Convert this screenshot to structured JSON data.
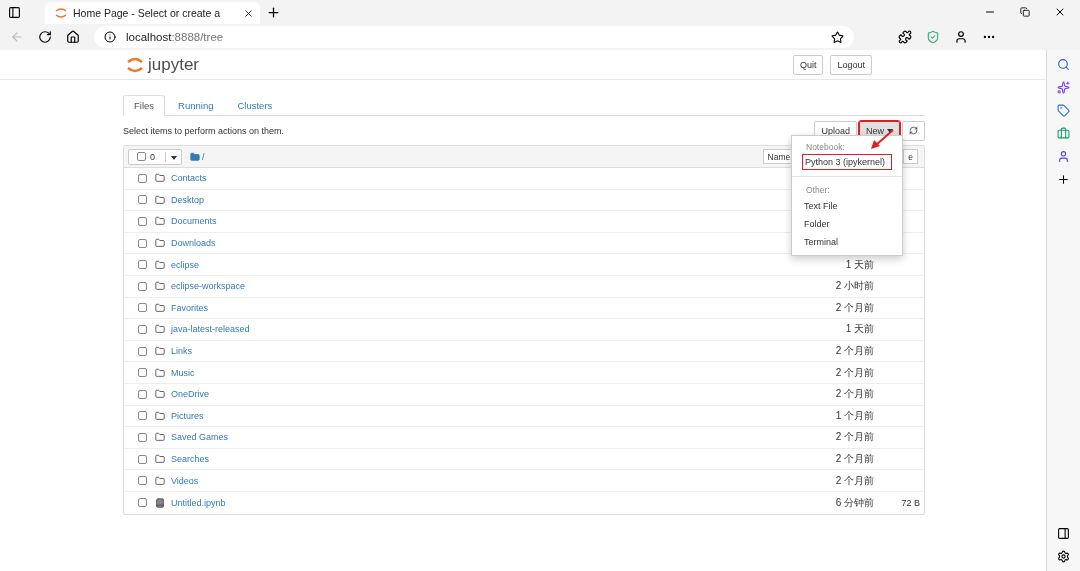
{
  "browser": {
    "tab_title": "Home Page - Select or create a",
    "url_host": "localhost",
    "url_rest": ":8888/tree"
  },
  "header": {
    "logo": "jupyter",
    "buttons": [
      "Quit",
      "Logout"
    ]
  },
  "tabs": [
    {
      "label": "Files",
      "selected": true
    },
    {
      "label": "Running",
      "selected": false
    },
    {
      "label": "Clusters",
      "selected": false
    }
  ],
  "toolbar": {
    "hint": "Select items to perform actions on them.",
    "upload": "Upload",
    "new": {
      "label": "New",
      "outlined": true
    }
  },
  "list_header": {
    "count": "0",
    "path": "/",
    "sort": "Name",
    "column_3": "e"
  },
  "rows": [
    {
      "kind": "folder",
      "name": "Contacts",
      "checked": false
    },
    {
      "kind": "folder",
      "name": "Desktop",
      "checked": false
    },
    {
      "kind": "folder",
      "name": "Documents",
      "checked": false
    },
    {
      "kind": "folder",
      "name": "Downloads",
      "checked": false
    },
    {
      "kind": "folder",
      "name": "eclipse",
      "checked": false,
      "modified": "1 天前"
    },
    {
      "kind": "folder",
      "name": "eclipse-workspace",
      "checked": false,
      "modified": "2 小时前"
    },
    {
      "kind": "folder",
      "name": "Favorites",
      "checked": false,
      "modified": "2 个月前"
    },
    {
      "kind": "folder",
      "name": "java-latest-released",
      "checked": false,
      "modified": "1 天前"
    },
    {
      "kind": "folder",
      "name": "Links",
      "checked": false,
      "modified": "2 个月前"
    },
    {
      "kind": "folder",
      "name": "Music",
      "checked": false,
      "modified": "2 个月前"
    },
    {
      "kind": "folder",
      "name": "OneDrive",
      "checked": false,
      "modified": "2 个月前"
    },
    {
      "kind": "folder",
      "name": "Pictures",
      "checked": false,
      "modified": "1 个月前"
    },
    {
      "kind": "folder",
      "name": "Saved Games",
      "checked": false,
      "modified": "2 个月前"
    },
    {
      "kind": "folder",
      "name": "Searches",
      "checked": false,
      "modified": "2 个月前"
    },
    {
      "kind": "folder",
      "name": "Videos",
      "checked": false,
      "modified": "2 个月前"
    },
    {
      "kind": "notebook",
      "name": "Untitled.ipynb",
      "checked": false,
      "modified": "6 分钟前",
      "size": "72 B"
    }
  ],
  "menu": {
    "sections": [
      {
        "heading": "Notebook:",
        "items": [
          {
            "label": "Python 3 (ipykernel)",
            "outlined": true
          }
        ]
      },
      {
        "heading": "Other:",
        "items": [
          {
            "label": "Text File",
            "outlined": false
          },
          {
            "label": "Folder",
            "outlined": false
          },
          {
            "label": "Terminal",
            "outlined": false
          }
        ]
      }
    ]
  }
}
